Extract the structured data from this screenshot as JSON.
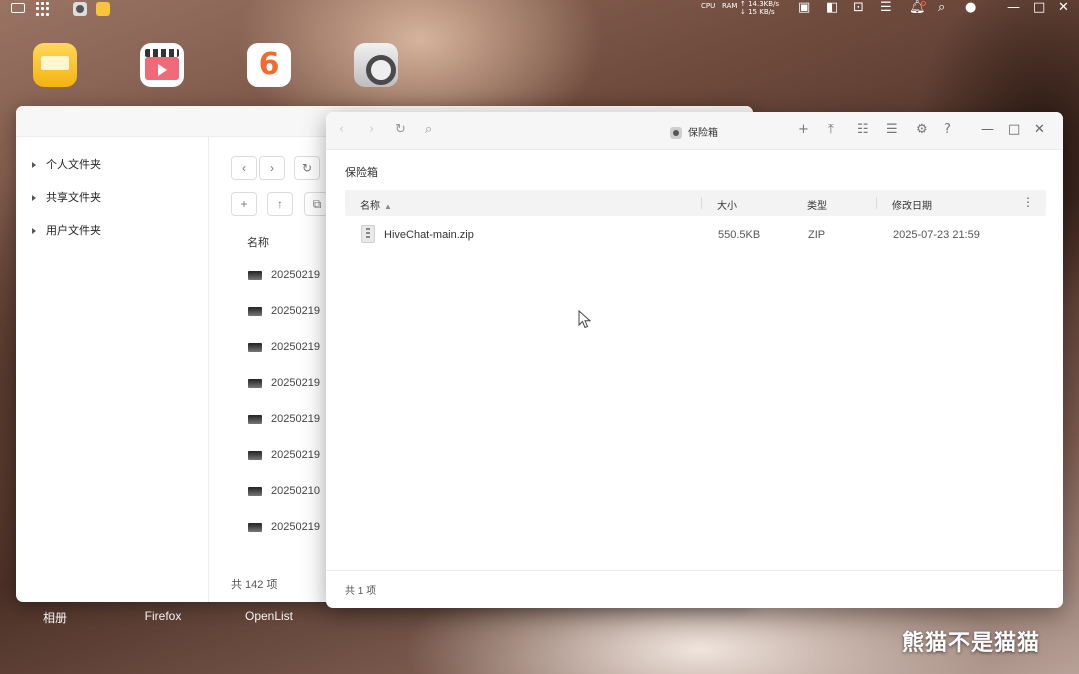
{
  "taskbar": {
    "net_up": "↑ 14.3KB/s",
    "net_down": "↓ 15 KB/s",
    "cpu_label": "CPU",
    "ram_label": "RAM",
    "icons": [
      "monitor-icon",
      "app-grid-icon",
      "safe-box-app-icon",
      "file-manager-app-icon",
      "widget-icon",
      "layout-icon",
      "screen-icon",
      "control-icon",
      "bell-icon",
      "search-icon",
      "user-icon",
      "minimize-icon",
      "maximize-icon",
      "close-icon"
    ]
  },
  "desktop": {
    "icons": [
      "folder-app-icon",
      "video-app-icon",
      "six-app-icon",
      "safe-app-icon"
    ],
    "labels": [
      "相册",
      "Firefox",
      "OpenList"
    ]
  },
  "file_manager": {
    "sidebar": [
      {
        "label": "个人文件夹"
      },
      {
        "label": "共享文件夹"
      },
      {
        "label": "用户文件夹"
      }
    ],
    "column_name": "名称",
    "rows": [
      "20250219",
      "20250219",
      "20250219",
      "20250219",
      "20250219",
      "20250219",
      "20250210",
      "20250219"
    ],
    "footer": "共 142 项"
  },
  "safe_box": {
    "window_title": "保险箱",
    "breadcrumb": "保险箱",
    "columns": {
      "name": "名称",
      "size": "大小",
      "type": "类型",
      "modified": "修改日期"
    },
    "files": [
      {
        "name": "HiveChat-main.zip",
        "size": "550.5KB",
        "type": "ZIP",
        "modified": "2025-07-23 21:59"
      }
    ],
    "footer": "共 1 项"
  },
  "watermark": "熊猫不是猫猫",
  "colors": {
    "accent_orange": "#f26a2d",
    "folder_yellow": "#f8c53a",
    "notification_dot": "#ff5a4a"
  }
}
